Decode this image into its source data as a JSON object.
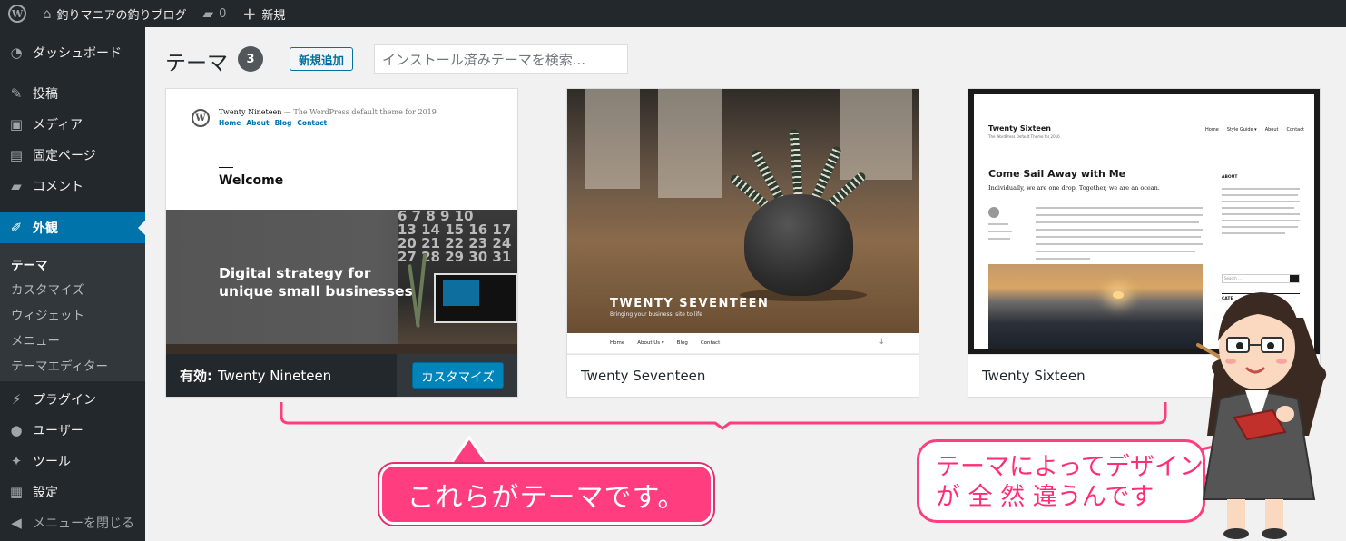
{
  "admin_bar": {
    "site_name": "釣りマニアの釣りブログ",
    "comment_count": "0",
    "new_label": "新規"
  },
  "sidebar": {
    "items": [
      {
        "label": "ダッシュボード",
        "icon": "gauge-icon"
      },
      {
        "label": "投稿",
        "icon": "pin-icon"
      },
      {
        "label": "メディア",
        "icon": "media-icon"
      },
      {
        "label": "固定ページ",
        "icon": "page-icon"
      },
      {
        "label": "コメント",
        "icon": "comment-icon"
      },
      {
        "label": "外観",
        "icon": "brush-icon"
      },
      {
        "label": "プラグイン",
        "icon": "plug-icon"
      },
      {
        "label": "ユーザー",
        "icon": "user-icon"
      },
      {
        "label": "ツール",
        "icon": "wrench-icon"
      },
      {
        "label": "設定",
        "icon": "settings-icon"
      }
    ],
    "submenu": [
      "テーマ",
      "カスタマイズ",
      "ウィジェット",
      "メニュー",
      "テーマエディター"
    ],
    "collapse_label": "メニューを閉じる"
  },
  "header": {
    "title": "テーマ",
    "count": "3",
    "add_new_label": "新規追加",
    "search_placeholder": "インストール済みテーマを検索..."
  },
  "themes": [
    {
      "name": "Twenty Nineteen",
      "active_label": "有効:",
      "customize_label": "カスタマイズ",
      "preview": {
        "site_title": "Twenty Nineteen",
        "tagline": "— The WordPress default theme for 2019",
        "nav": [
          "Home",
          "About",
          "Blog",
          "Contact"
        ],
        "welcome": "Welcome",
        "headline_1": "Digital strategy for",
        "headline_2": "unique small businesses",
        "calendar": [
          "6 7 8 9 10",
          "13 14 15 16 17",
          "20 21 22 23 24",
          "27 28 29 30 31"
        ]
      }
    },
    {
      "name": "Twenty Seventeen",
      "preview": {
        "title": "TWENTY SEVENTEEN",
        "tagline": "Bringing your business' site to life",
        "nav": [
          "Home",
          "About Us ▾",
          "Blog",
          "Contact"
        ]
      }
    },
    {
      "name": "Twenty Sixteen",
      "preview": {
        "site_title": "Twenty Sixteen",
        "site_tagline": "The WordPress Default Theme for 2016",
        "nav": [
          "Home",
          "Style Guide ▾",
          "About",
          "Contact"
        ],
        "post_title": "Come Sail Away with Me",
        "lead": "Individually, we are one drop.  Together, we are an ocean.",
        "side_heading_1": "ABOUT",
        "side_heading_2": "CATE",
        "search_label": "Search …"
      }
    }
  ],
  "annotations": {
    "main_callout": "これらがテーマです。",
    "bubble_line_1": "テーマによってデザイン",
    "bubble_line_2": "が 全 然 違うんです"
  },
  "colors": {
    "admin_dark": "#23282d",
    "admin_blue": "#0073aa",
    "callout_pink": "#ff3d7f"
  }
}
